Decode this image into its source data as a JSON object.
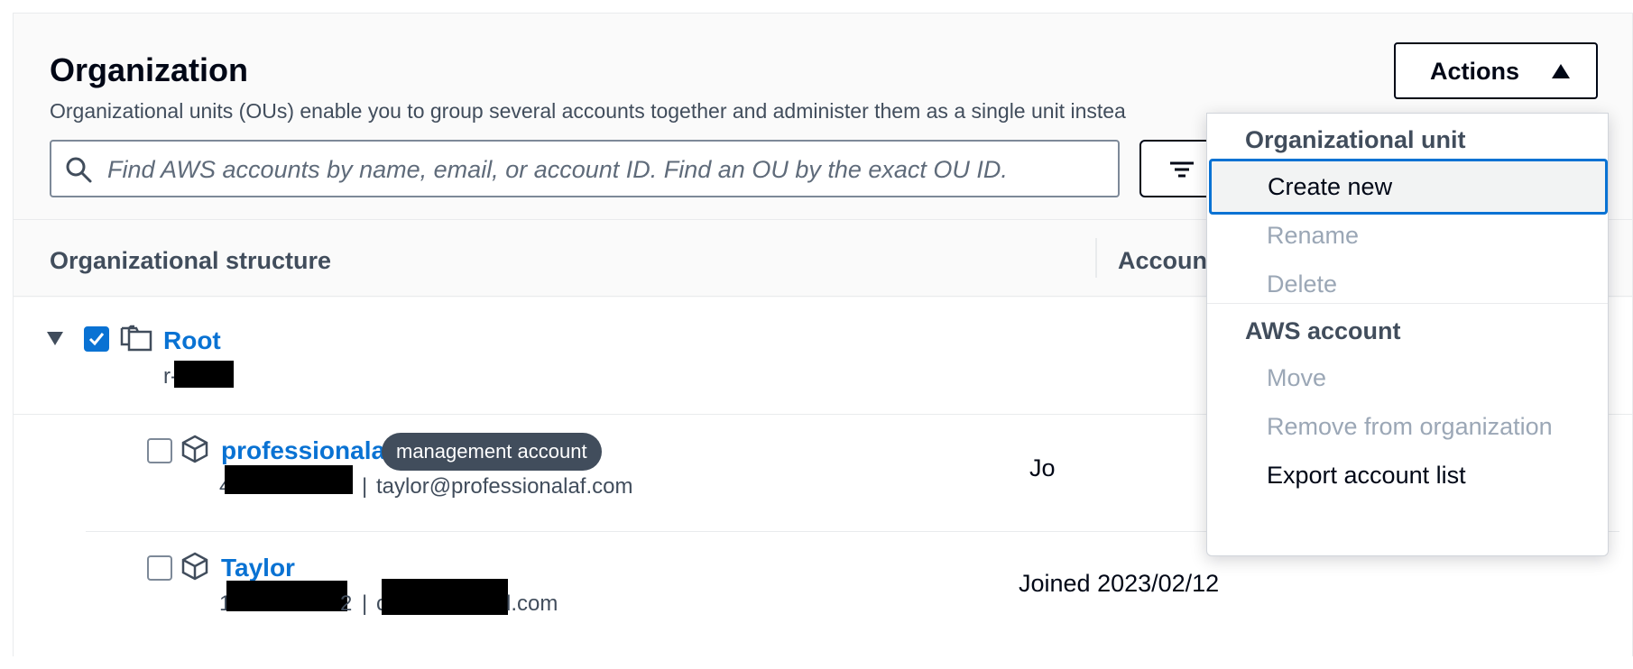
{
  "header": {
    "title": "Organization",
    "description": "Organizational units (OUs) enable you to group several accounts together and administer them as a single unit instea"
  },
  "search": {
    "placeholder": "Find AWS accounts by name, email, or account ID. Find an OU by the exact OU ID."
  },
  "actions_button": {
    "label": "Actions"
  },
  "table": {
    "columns": [
      "Organizational structure",
      "Accoun"
    ]
  },
  "tree": {
    "root": {
      "name": "Root",
      "id_prefix": "r-",
      "checked": true
    },
    "accounts": [
      {
        "name": "professionalaf",
        "badge": "management account",
        "id_prefix": "4",
        "separator": "|",
        "email": "taylor@professionalaf.com",
        "joined": "Jo"
      },
      {
        "name": "Taylor",
        "id_prefix": "1",
        "id_suffix": "2",
        "separator": "|",
        "email_prefix": "c",
        "email_suffix": "l.com",
        "joined": "Joined 2023/02/12"
      }
    ]
  },
  "dropdown": {
    "groups": [
      {
        "label": "Organizational unit",
        "items": [
          {
            "label": "Create new",
            "state": "focused"
          },
          {
            "label": "Rename",
            "state": "disabled"
          },
          {
            "label": "Delete",
            "state": "disabled"
          }
        ]
      },
      {
        "label": "AWS account",
        "items": [
          {
            "label": "Move",
            "state": "disabled"
          },
          {
            "label": "Remove from organization",
            "state": "disabled"
          },
          {
            "label": "Export account list",
            "state": "enabled"
          }
        ]
      }
    ]
  },
  "colors": {
    "link": "#0972d3",
    "badge_bg": "#414d5c",
    "disabled_text": "#9ba7b6",
    "focus_ring": "#0972d3"
  }
}
